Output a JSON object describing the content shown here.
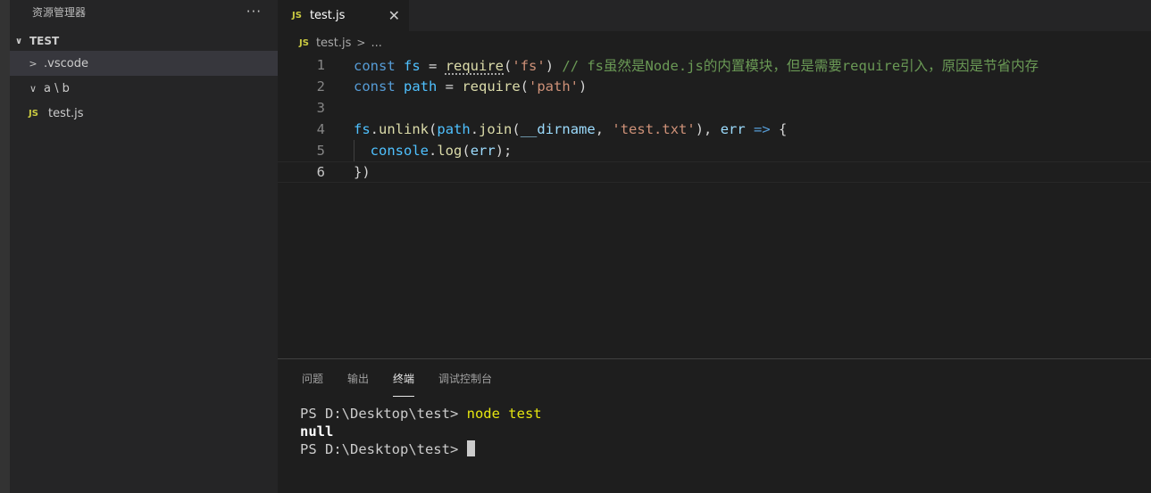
{
  "explorer": {
    "header": "资源管理器",
    "more": "···",
    "section": "TEST",
    "items": [
      {
        "label": ".vscode",
        "chevron": ">"
      },
      {
        "label": "a \\ b",
        "chevron": "∨"
      },
      {
        "label": "test.js",
        "icon": "JS"
      }
    ]
  },
  "editor": {
    "tab": {
      "icon": "JS",
      "label": "test.js",
      "close": "✕"
    },
    "breadcrumb": {
      "icon": "JS",
      "file": "test.js",
      "sep": ">",
      "rest": "..."
    },
    "lines": [
      {
        "n": "1"
      },
      {
        "n": "2"
      },
      {
        "n": "3"
      },
      {
        "n": "4"
      },
      {
        "n": "5"
      },
      {
        "n": "6"
      }
    ],
    "tokens": {
      "const": "const",
      "fs": "fs",
      "eq": " = ",
      "require": "require",
      "fs_str": "'fs'",
      "comment": "// fs虽然是Node.js的内置模块，但是需要require引入，原因是节省内存",
      "path": "path",
      "path_str": "'path'",
      "unlink": "unlink",
      "join": "join",
      "dirname": "__dirname",
      "txt_str": "'test.txt'",
      "err": "err",
      "arrow": "=>",
      "console": "console",
      "log": "log"
    }
  },
  "panel": {
    "tabs": [
      "问题",
      "输出",
      "终端",
      "调试控制台"
    ],
    "active": "终端",
    "terminal": {
      "prompt1": "PS D:\\Desktop\\test> ",
      "cmd": "node test",
      "output": "null",
      "prompt2": "PS D:\\Desktop\\test> "
    }
  },
  "colors": {
    "keyword": "#569cd6",
    "string": "#ce9178",
    "comment": "#6a9955",
    "function": "#dcdcaa",
    "js_icon": "#cbcb41"
  }
}
